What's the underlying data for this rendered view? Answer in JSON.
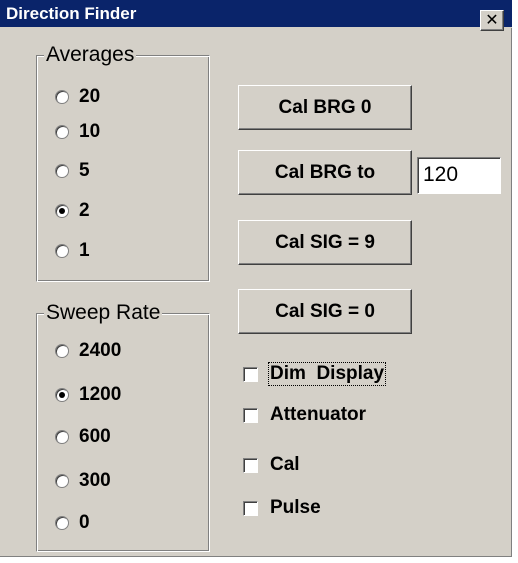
{
  "window": {
    "title": "Direction Finder",
    "close_glyph": "✕"
  },
  "averages": {
    "label": "Averages",
    "options": [
      {
        "label": "20",
        "selected": false
      },
      {
        "label": "10",
        "selected": false
      },
      {
        "label": "5",
        "selected": false
      },
      {
        "label": "2",
        "selected": true
      },
      {
        "label": "1",
        "selected": false
      }
    ]
  },
  "sweep_rate": {
    "label": "Sweep Rate",
    "options": [
      {
        "label": "2400",
        "selected": false
      },
      {
        "label": "1200",
        "selected": true
      },
      {
        "label": "600",
        "selected": false
      },
      {
        "label": "300",
        "selected": false
      },
      {
        "label": "0",
        "selected": false
      }
    ]
  },
  "buttons": {
    "cal_brg_0": "Cal BRG 0",
    "cal_brg_to": "Cal BRG to",
    "cal_sig_9": "Cal SIG = 9",
    "cal_sig_0": "Cal SIG = 0"
  },
  "cal_brg_value": "120",
  "checkboxes": {
    "dim_display": {
      "label": "Dim  Display",
      "checked": false
    },
    "attenuator": {
      "label": "Attenuator",
      "checked": false
    },
    "cal": {
      "label": "Cal",
      "checked": false
    },
    "pulse": {
      "label": "Pulse",
      "checked": false
    }
  }
}
